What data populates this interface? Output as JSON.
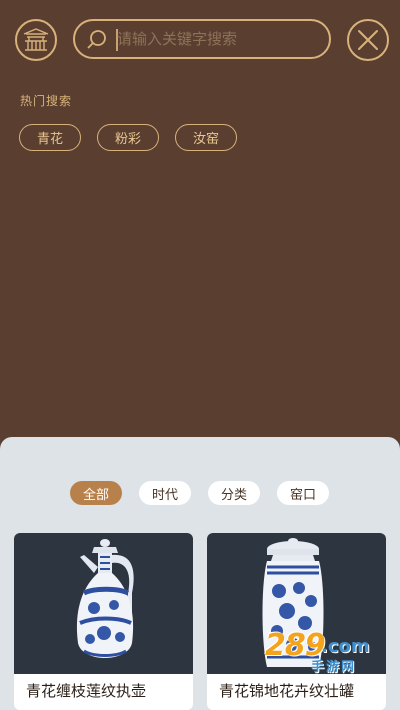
{
  "search": {
    "placeholder": "请输入关键字搜索"
  },
  "hot": {
    "title": "热门搜索",
    "tags": [
      "青花",
      "粉彩",
      "汝窑"
    ]
  },
  "filter": {
    "tabs": [
      "全部",
      "时代",
      "分类",
      "窑口"
    ],
    "active_index": 0
  },
  "cards": [
    {
      "caption": "青花缠枝莲纹执壶"
    },
    {
      "caption": "青花锦地花卉纹壮罐"
    }
  ],
  "watermark": {
    "number": "289",
    "domain": ".com",
    "subtitle": "手游网"
  },
  "colors": {
    "background": "#5a3f31",
    "accent_gold": "#d8b27a",
    "active_tab": "#b8814c",
    "sheet": "#dde3e6"
  },
  "icons": {
    "home": "pavilion-icon",
    "search": "search-icon",
    "close": "close-icon"
  }
}
